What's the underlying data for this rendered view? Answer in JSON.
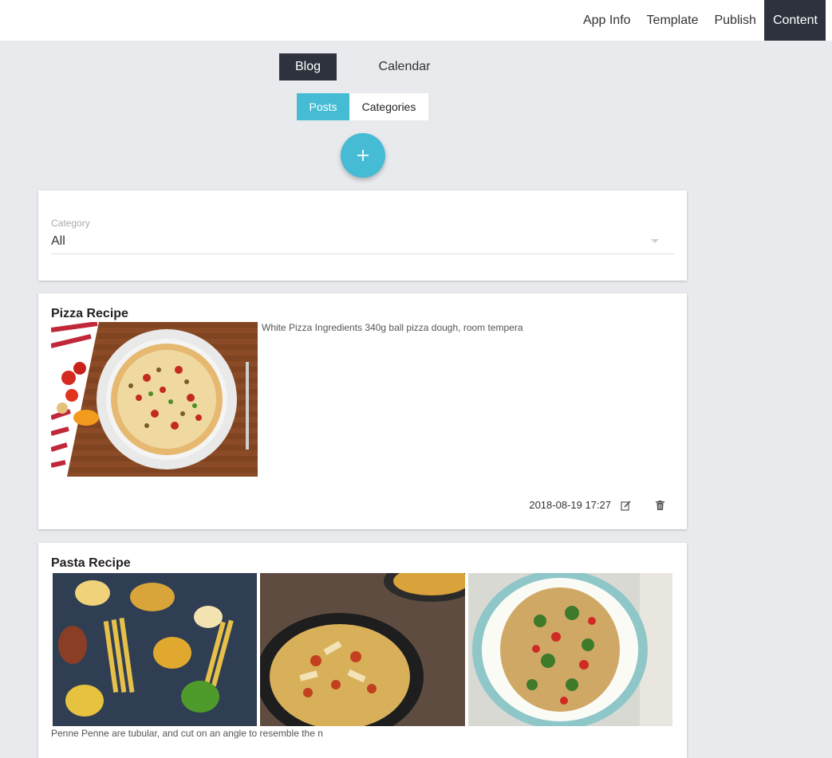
{
  "topnav": {
    "items": [
      {
        "label": "App Info",
        "active": false
      },
      {
        "label": "Template",
        "active": false
      },
      {
        "label": "Publish",
        "active": false
      },
      {
        "label": "Content",
        "active": true
      }
    ]
  },
  "primary_tabs": [
    {
      "label": "Blog",
      "active": true
    },
    {
      "label": "Calendar",
      "active": false
    }
  ],
  "secondary_tabs": [
    {
      "label": "Posts",
      "active": true
    },
    {
      "label": "Categories",
      "active": false
    }
  ],
  "fab": {
    "icon": "plus-icon"
  },
  "filter": {
    "label": "Category",
    "value": "All"
  },
  "posts": [
    {
      "title": "Pizza Recipe",
      "excerpt": "White Pizza Ingredients 340g ball pizza dough, room tempera",
      "images": [
        "pizza-photo"
      ],
      "date": "2018-08-19 17:27",
      "actions": [
        "edit-icon",
        "trash-icon"
      ]
    },
    {
      "title": "Pasta Recipe",
      "excerpt": "Penne Penne are tubular, and cut on an angle to resemble the n",
      "images": [
        "raw-pasta-photo",
        "penne-bowl-photo",
        "spaghetti-plate-photo"
      ]
    }
  ],
  "colors": {
    "accent": "#45bcd3",
    "dark": "#2d323e",
    "background": "#e9eaee"
  }
}
